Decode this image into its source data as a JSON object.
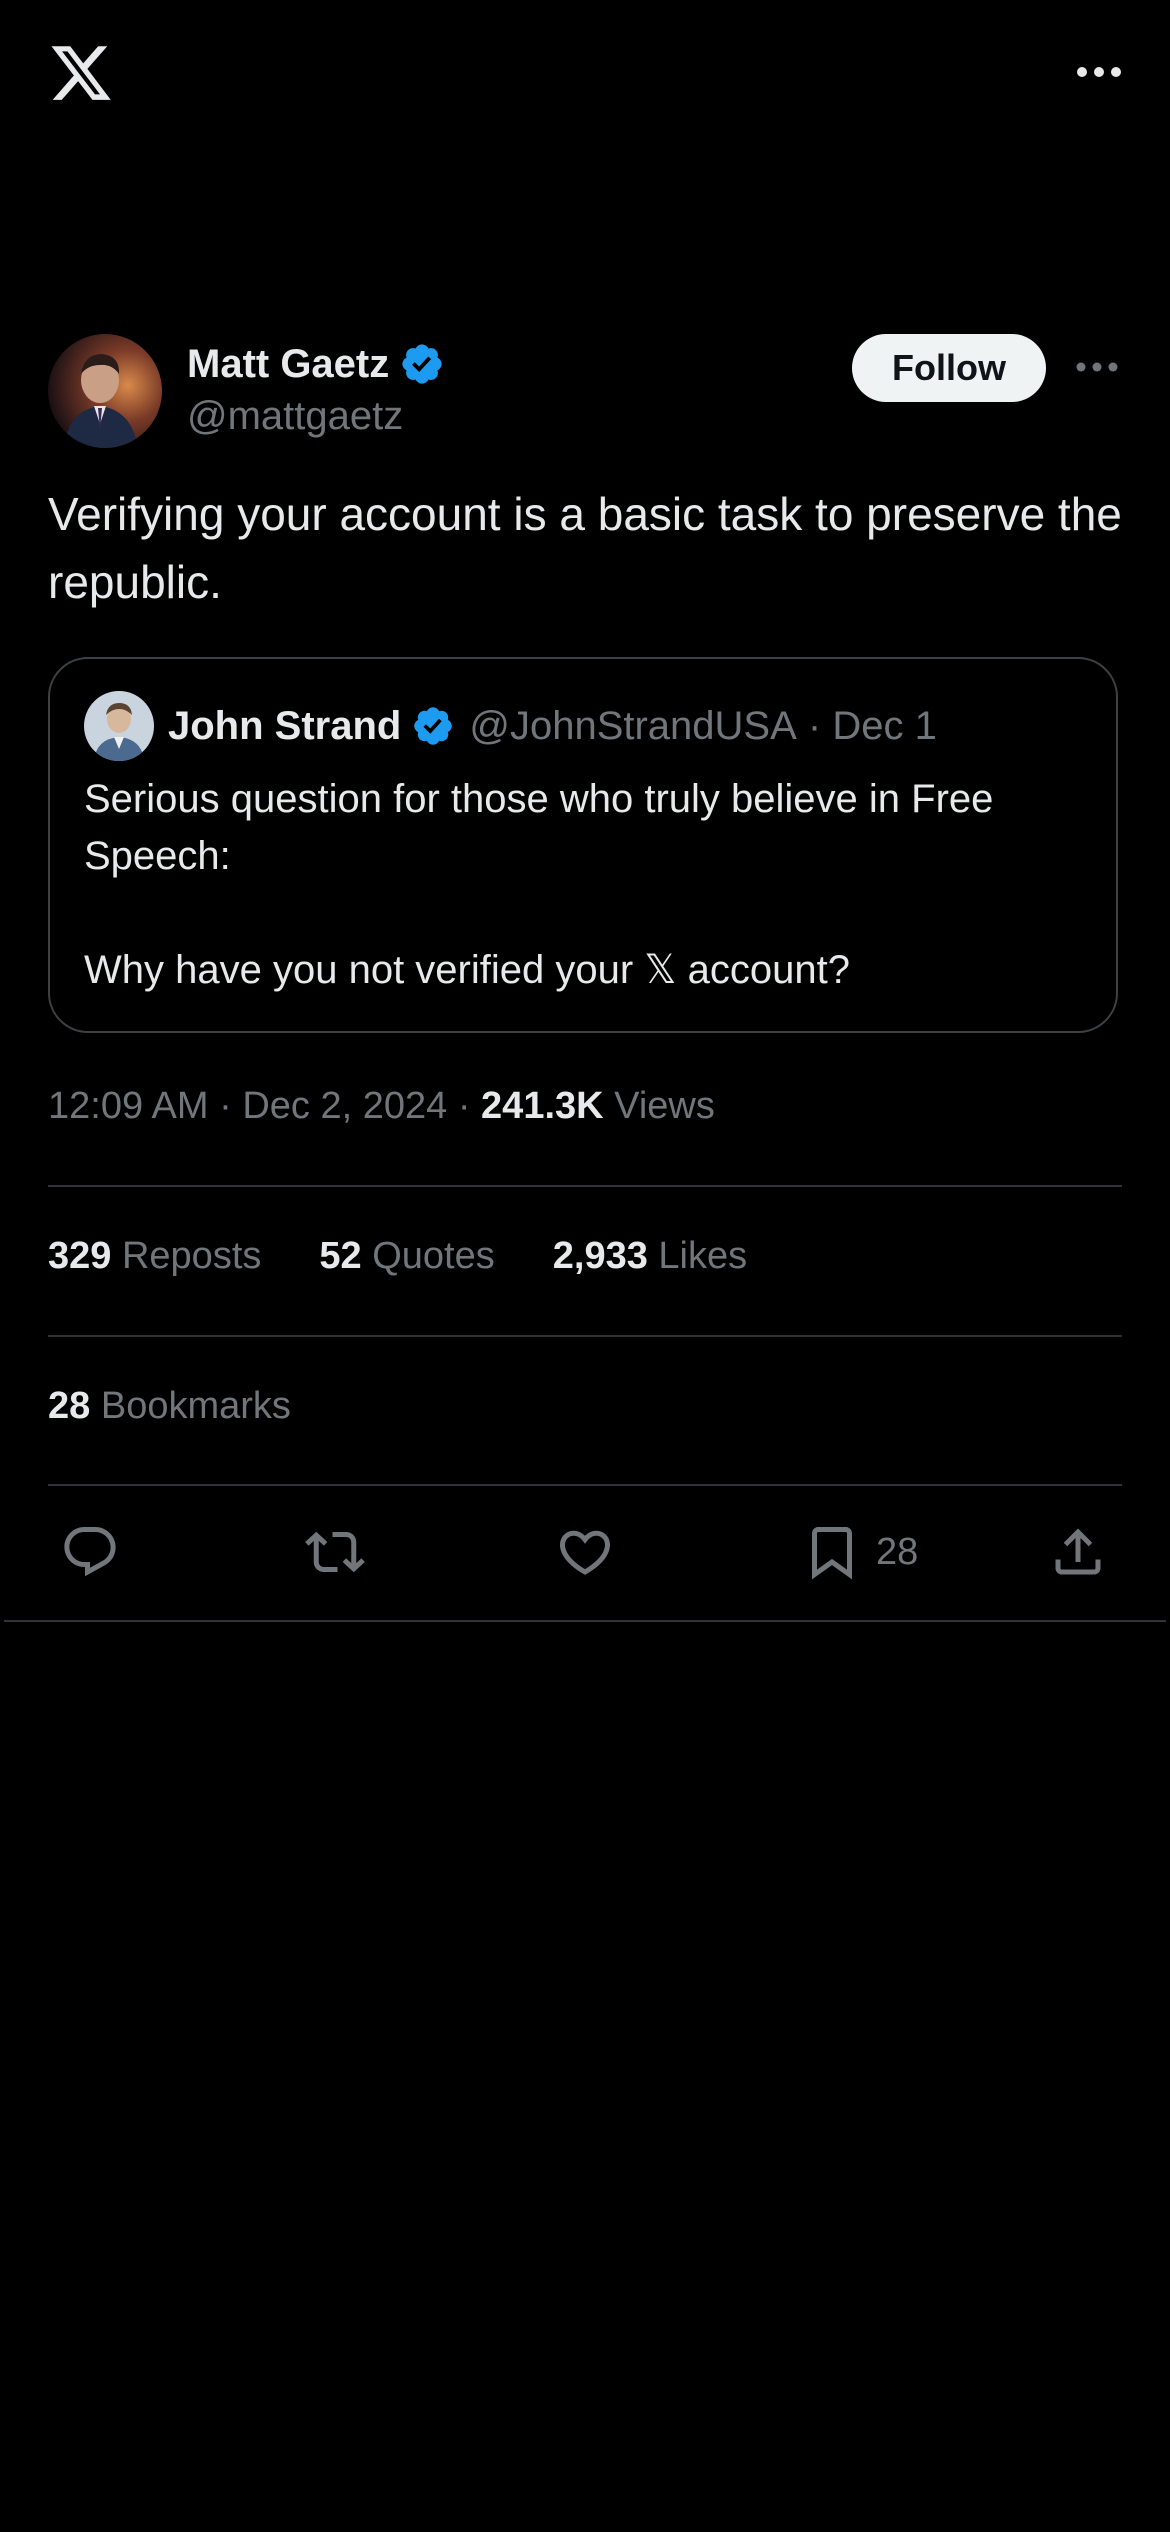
{
  "topbar": {
    "logo_icon": "x-logo-icon",
    "more_icon": "more-horizontal-icon"
  },
  "tweet": {
    "author": {
      "display_name": "Matt Gaetz",
      "handle": "@mattgaetz",
      "verified": true,
      "verified_color": "#1d9bf0"
    },
    "follow_label": "Follow",
    "text": "Verifying your account is a basic task to preserve the republic.",
    "quote": {
      "display_name": "John Strand",
      "handle": "@JohnStrandUSA",
      "separator": " · ",
      "date": "Dec 1",
      "text": "Serious question for those who truly believe in Free Speech:\n\nWhy have you not verified your 𝕏 account?"
    },
    "time": "12:09 AM",
    "date": "Dec 2, 2024",
    "views_count": "241.3K",
    "views_label": "Views",
    "stats": {
      "reposts_count": "329",
      "reposts_label": "Reposts",
      "quotes_count": "52",
      "quotes_label": "Quotes",
      "likes_count": "2,933",
      "likes_label": "Likes",
      "bookmarks_count": "28",
      "bookmarks_label": "Bookmarks"
    },
    "actions": {
      "reply_icon": "reply-icon",
      "repost_icon": "repost-icon",
      "like_icon": "heart-icon",
      "bookmark_icon": "bookmark-icon",
      "bookmark_count": "28",
      "share_icon": "share-icon"
    }
  },
  "colors": {
    "background": "#000000",
    "text_primary": "#e7e9ea",
    "text_secondary": "#71767b",
    "divider": "#2f3336",
    "verified_blue": "#1d9bf0",
    "follow_bg": "#eff3f4"
  }
}
